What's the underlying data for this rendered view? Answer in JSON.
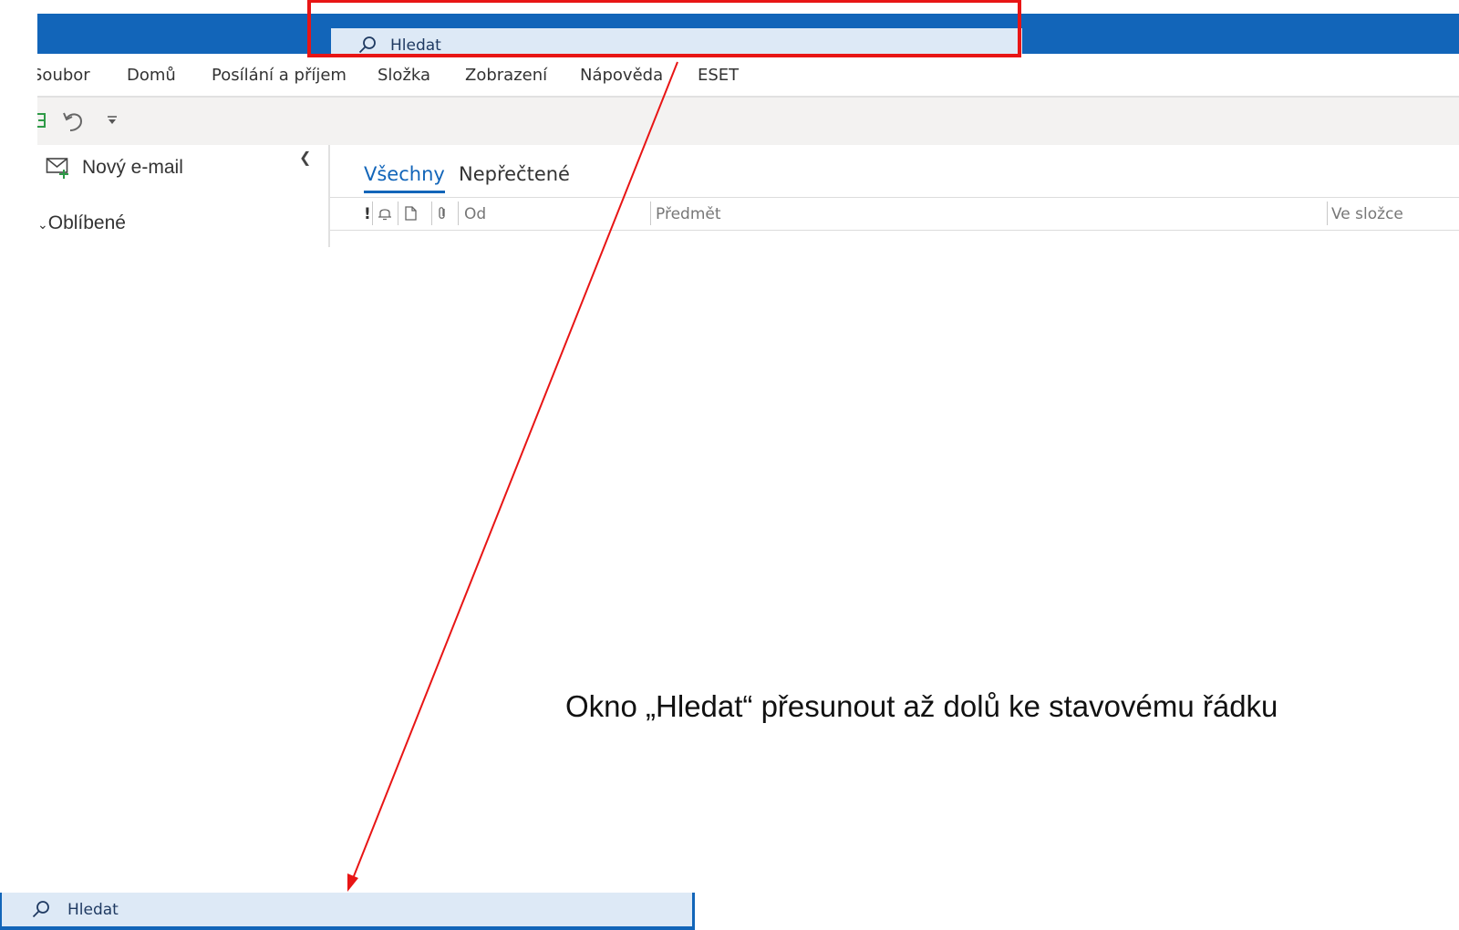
{
  "search": {
    "label": "Hledat"
  },
  "menu": {
    "items": [
      "Soubor",
      "Domů",
      "Posílání a příjem",
      "Složka",
      "Zobrazení",
      "Nápověda",
      "ESET"
    ]
  },
  "nav": {
    "new_mail": "Nový e-mail",
    "favorites": "Oblíbené"
  },
  "mail_list": {
    "tabs": [
      "Všechny",
      "Nepřečtené"
    ],
    "columns": {
      "importance": "!",
      "from": "Od",
      "subject": "Předmět",
      "folder": "Ve složce"
    }
  },
  "annotation": {
    "caption": "Okno „Hledat“ přesunout až dolů ke stavovému řádku",
    "highlight_color": "#e81515"
  },
  "colors": {
    "titlebar": "#1265b9",
    "search_bg": "#dde9f6",
    "accent": "#1265b9"
  }
}
